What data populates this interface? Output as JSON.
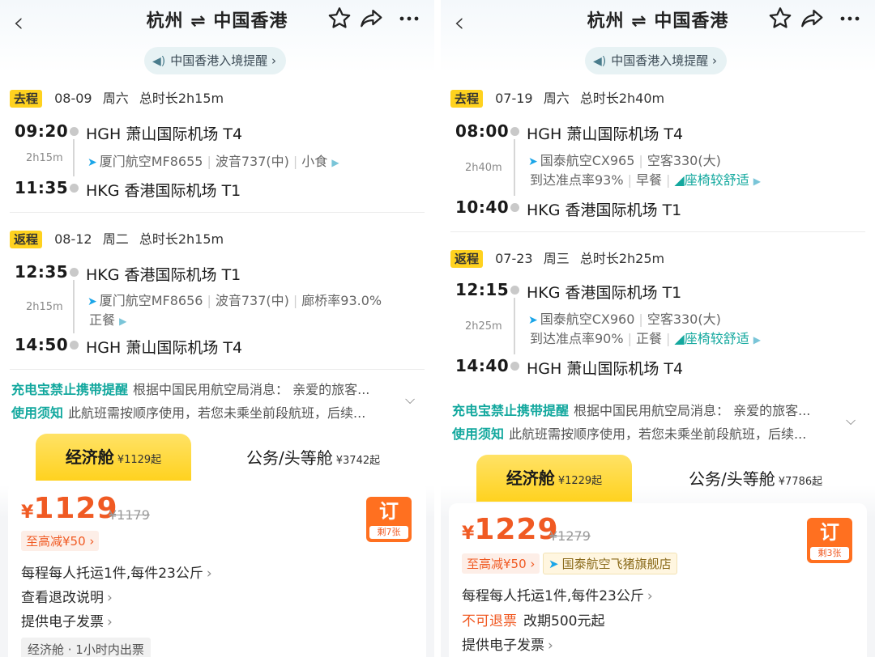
{
  "left": {
    "title": "杭州 ⇌ 中国香港",
    "notice": "中国香港入境提醒 ›",
    "outbound": {
      "badge": "去程",
      "date": "08-09",
      "weekday": "周六",
      "total": "总时长2h15m",
      "dep_time": "09:20",
      "dep_code": "HGH",
      "dep_airport": "萧山国际机场 T4",
      "duration": "2h15m",
      "airline": "厦门航空MF8655",
      "aircraft": "波音737(中)",
      "meal": "小食",
      "arr_time": "11:35",
      "arr_code": "HKG",
      "arr_airport": "香港国际机场 T1"
    },
    "inbound": {
      "badge": "返程",
      "date": "08-12",
      "weekday": "周二",
      "total": "总时长2h15m",
      "dep_time": "12:35",
      "dep_code": "HKG",
      "dep_airport": "香港国际机场 T1",
      "duration": "2h15m",
      "airline": "厦门航空MF8656",
      "aircraft": "波音737(中)",
      "bridge": "廊桥率93.0%",
      "meal": "正餐",
      "arr_time": "14:50",
      "arr_code": "HGH",
      "arr_airport": "萧山国际机场 T4"
    },
    "tip1_label": "充电宝禁止携带提醒",
    "tip1_text": "根据中国民用航空局消息： 亲爱的旅客...",
    "tip2_label": "使用须知",
    "tip2_text": "此航班需按顺序使用，若您未乘坐前段航班，后续...",
    "tab_economy": "经济舱",
    "tab_economy_price": "¥1129起",
    "tab_business": "公务/头等舱",
    "tab_business_price": "¥3742起",
    "price_yen": "¥",
    "price": "1129",
    "orig_price": "¥1179",
    "promo": "至高减¥50 ›",
    "book": "订",
    "remain": "剩7张",
    "line1": "每程每人托运1件,每件23公斤",
    "line2": "查看退改说明",
    "line3": "提供电子发票",
    "chip": "经济舱 · 1小时内出票"
  },
  "right": {
    "title": "杭州 ⇌ 中国香港",
    "notice": "中国香港入境提醒 ›",
    "outbound": {
      "badge": "去程",
      "date": "07-19",
      "weekday": "周六",
      "total": "总时长2h40m",
      "dep_time": "08:00",
      "dep_code": "HGH",
      "dep_airport": "萧山国际机场 T4",
      "duration": "2h40m",
      "airline": "国泰航空CX965",
      "aircraft": "空客330(大)",
      "ontime": "到达准点率93%",
      "meal": "早餐",
      "comfort": "座椅较舒适",
      "arr_time": "10:40",
      "arr_code": "HKG",
      "arr_airport": "香港国际机场 T1"
    },
    "inbound": {
      "badge": "返程",
      "date": "07-23",
      "weekday": "周三",
      "total": "总时长2h25m",
      "dep_time": "12:15",
      "dep_code": "HKG",
      "dep_airport": "香港国际机场 T1",
      "duration": "2h25m",
      "airline": "国泰航空CX960",
      "aircraft": "空客330(大)",
      "ontime": "到达准点率90%",
      "meal": "正餐",
      "comfort": "座椅较舒适",
      "arr_time": "14:40",
      "arr_code": "HGH",
      "arr_airport": "萧山国际机场 T4"
    },
    "tip1_label": "充电宝禁止携带提醒",
    "tip1_text": "根据中国民用航空局消息： 亲爱的旅客...",
    "tip2_label": "使用须知",
    "tip2_text": "此航班需按顺序使用，若您未乘坐前段航班，后续...",
    "tab_economy": "经济舱",
    "tab_economy_price": "¥1229起",
    "tab_business": "公务/头等舱",
    "tab_business_price": "¥7786起",
    "price_yen": "¥",
    "price": "1229",
    "orig_price": "¥1279",
    "promo": "至高减¥50 ›",
    "store": "国泰航空飞猪旗舰店",
    "book": "订",
    "remain": "剩3张",
    "line1": "每程每人托运1件,每件23公斤",
    "refund_red": "不可退票",
    "refund_text": "改期500元起",
    "line3": "提供电子发票"
  },
  "colors": {
    "accent": "#f05a23",
    "badge": "#ffd21f",
    "teal": "#13a89e",
    "book": "#ff7020"
  },
  "icons": {
    "back": "back-icon",
    "star": "star-icon",
    "share": "share-icon",
    "more": "more-icon"
  }
}
